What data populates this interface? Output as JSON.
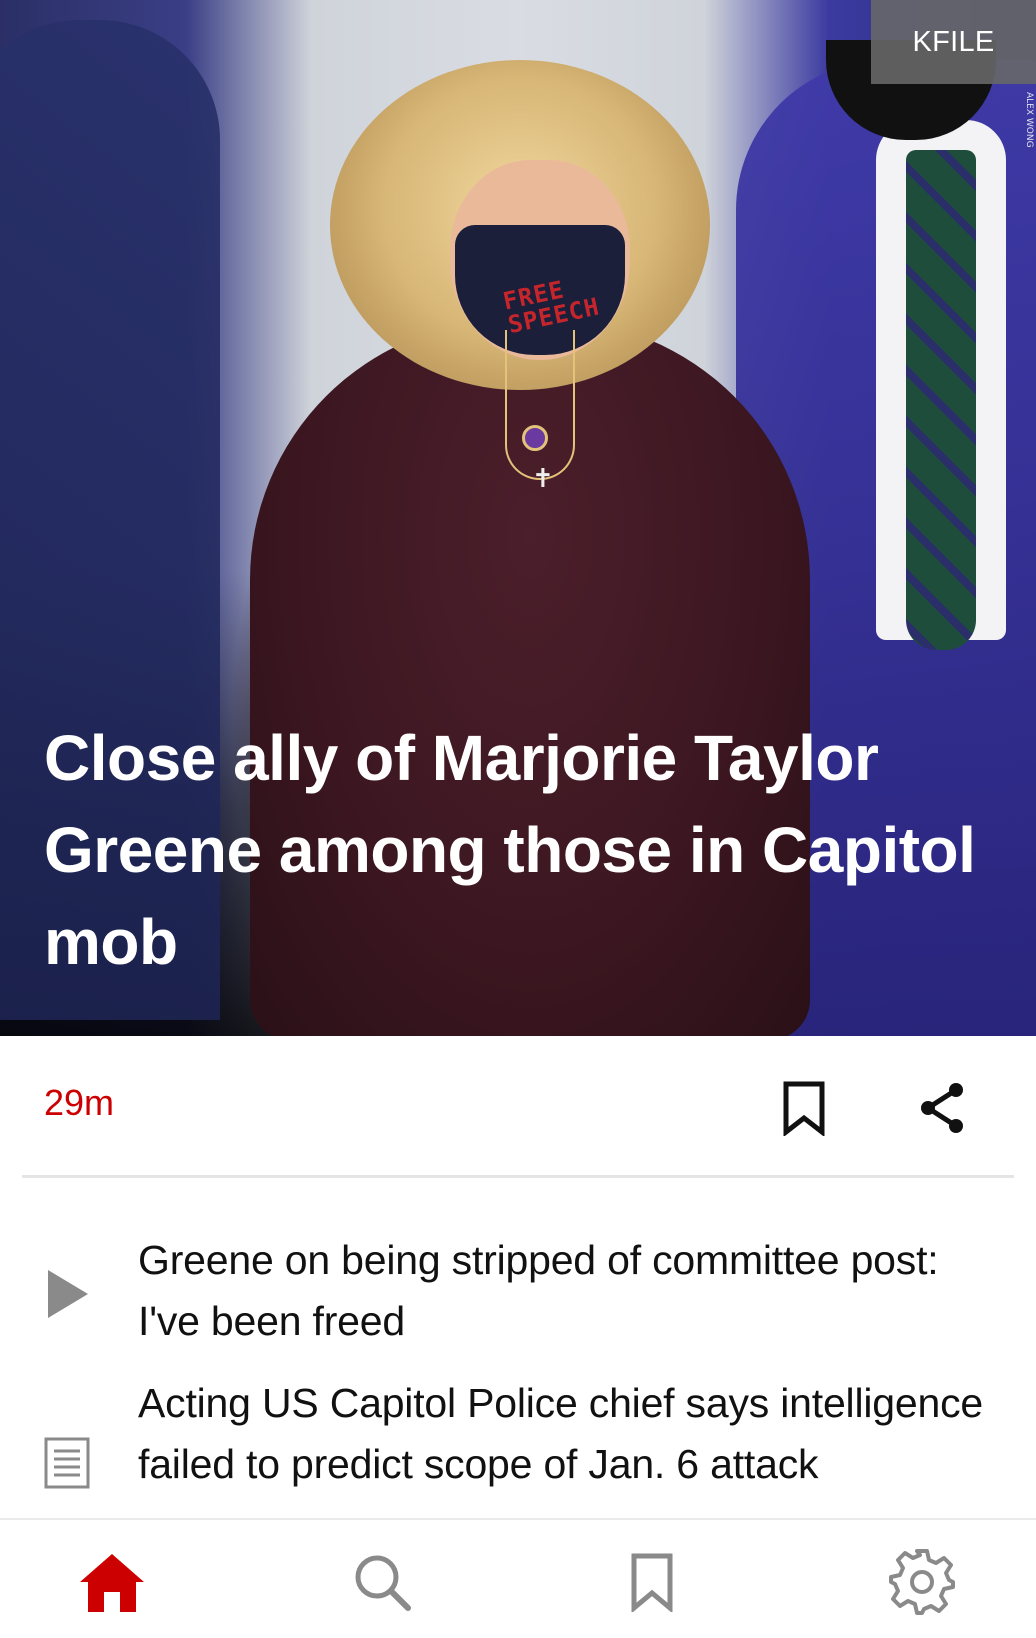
{
  "hero": {
    "source_badge": "KFILE",
    "photo_credit": "ALEX WONG",
    "mask_text_line1": "FREE",
    "mask_text_line2": "SPEECH",
    "headline": "Close ally of Marjorie Taylor Greene among those in Capitol mob"
  },
  "meta": {
    "timestamp": "29m",
    "bookmark_icon": "bookmark-icon",
    "share_icon": "share-icon"
  },
  "related": [
    {
      "type": "video",
      "icon": "play-icon",
      "title": "Greene on being stripped of committee post: I've been freed"
    },
    {
      "type": "article",
      "icon": "article-icon",
      "title": "Acting US Capitol Police chief says intelligence failed to predict scope of Jan. 6 attack"
    }
  ],
  "nav": {
    "items": [
      {
        "id": "home",
        "icon": "home-icon",
        "active": true
      },
      {
        "id": "search",
        "icon": "search-icon",
        "active": false
      },
      {
        "id": "saved",
        "icon": "bookmark-icon",
        "active": false
      },
      {
        "id": "settings",
        "icon": "gear-icon",
        "active": false
      }
    ]
  },
  "colors": {
    "accent": "#cc0000",
    "text": "#111111",
    "icon_gray": "#8a8a8a",
    "badge_bg": "#696969"
  }
}
